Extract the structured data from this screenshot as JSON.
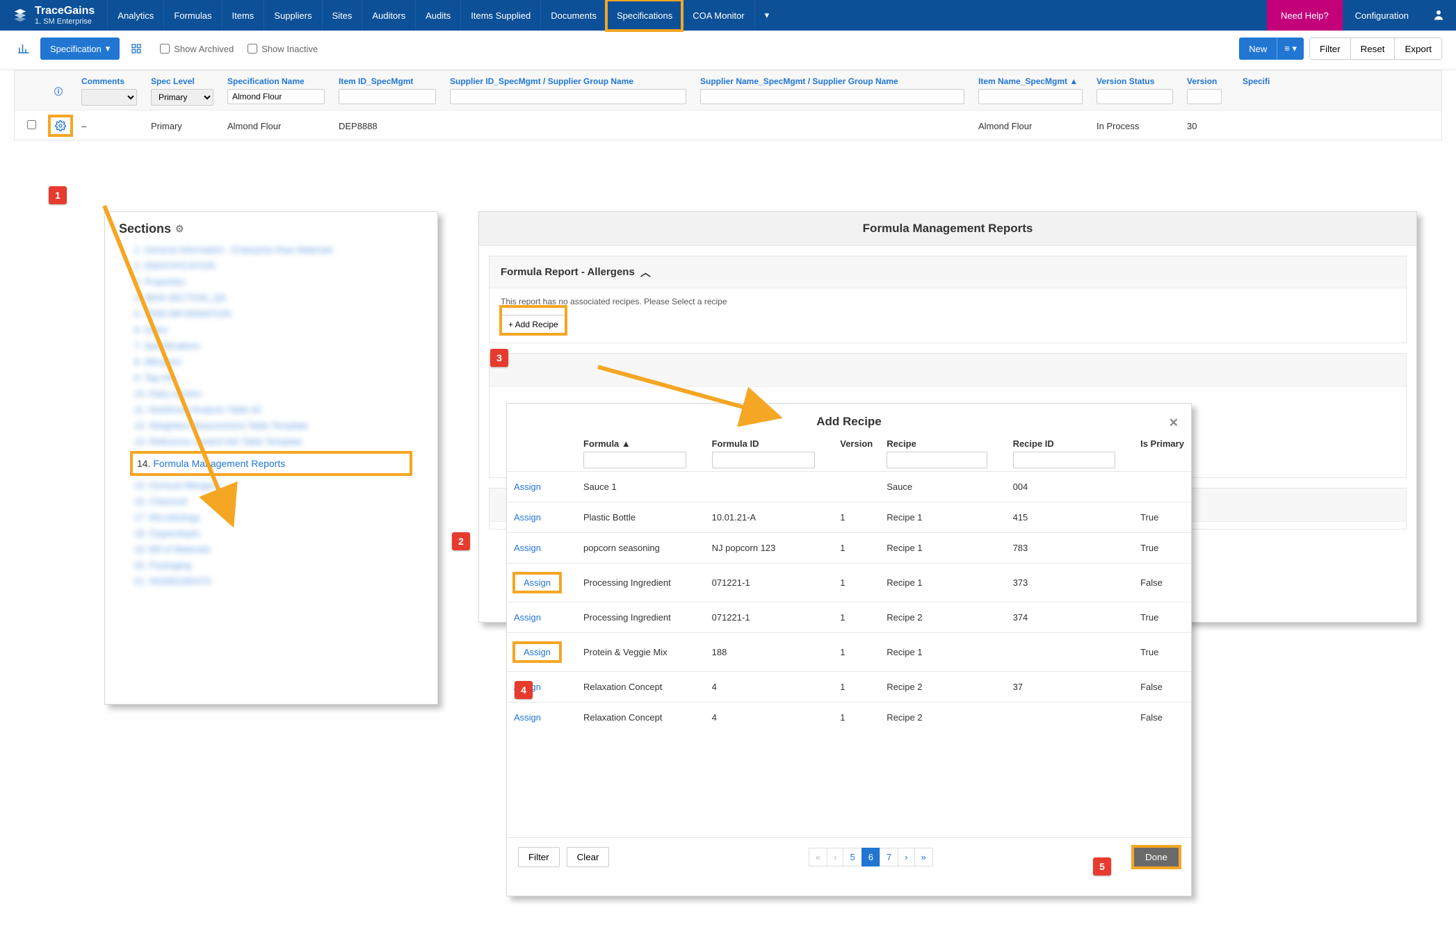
{
  "brand": {
    "name": "TraceGains",
    "sub": "1. SM Enterprise"
  },
  "nav": {
    "items": [
      "Analytics",
      "Formulas",
      "Items",
      "Suppliers",
      "Sites",
      "Auditors",
      "Audits",
      "Items Supplied",
      "Documents",
      "Specifications",
      "COA Monitor"
    ],
    "active": "Specifications",
    "needHelp": "Need Help?",
    "config": "Configuration"
  },
  "filterbar": {
    "specBtn": "Specification",
    "showArchived": "Show Archived",
    "showInactive": "Show Inactive",
    "new": "New",
    "filter": "Filter",
    "reset": "Reset",
    "export": "Export"
  },
  "grid": {
    "cols": {
      "comments": "Comments",
      "specLevel": "Spec Level",
      "specName": "Specification Name",
      "itemId": "Item ID_SpecMgmt",
      "supplierId": "Supplier ID_SpecMgmt / Supplier Group Name",
      "supplierName": "Supplier Name_SpecMgmt / Supplier Group Name",
      "itemName": "Item Name_SpecMgmt ▲",
      "versionStatus": "Version Status",
      "version": "Version",
      "specific": "Specifi"
    },
    "filterValues": {
      "specLevel": "Primary",
      "specName": "Almond Flour"
    },
    "row": {
      "comments": "–",
      "specLevel": "Primary",
      "specName": "Almond Flour",
      "itemId": "DEP8888",
      "supplierId": "",
      "supplierName": "",
      "itemName": "Almond Flour",
      "versionStatus": "In Process",
      "version": "30"
    }
  },
  "sections": {
    "title": "Sections",
    "activeIndex": "14.",
    "activeLabel": "Formula Management Reports",
    "blurred": [
      "1. General Information - Enterprise Raw Materials",
      "2. IDENTIFICATION",
      "3. Properties",
      "4. NEW SECTION_QA",
      "5. ITEM INFORMATION",
      "6. Dates",
      "7. Specifications",
      "8. Allergens",
      "9. Tag Info",
      "10. Dairy section",
      "11. Nutritional Analysis Table 62",
      "12. Weighted Measurement Table Template",
      "13. Reference content link Table Template",
      "15. General Allergens",
      "16. Chemical",
      "17. Microbiology",
      "18. Organoleptic",
      "19. Bill of Materials",
      "20. Packaging",
      "21. INGREDIENTS"
    ]
  },
  "report": {
    "header": "Formula Management Reports",
    "cardTitle": "Formula Report - Allergens",
    "msg": "This report has no associated recipes. Please Select a recipe",
    "addRecipe": "+ Add Recipe"
  },
  "dialog": {
    "title": "Add Recipe",
    "cols": {
      "formula": "Formula ▲",
      "formulaId": "Formula ID",
      "version": "Version",
      "recipe": "Recipe",
      "recipeId": "Recipe ID",
      "primary": "Is Primary"
    },
    "assign": "Assign",
    "rows": [
      {
        "formula": "Sauce 1",
        "formulaId": "",
        "version": "",
        "recipe": "Sauce",
        "recipeId": "004",
        "primary": ""
      },
      {
        "formula": "Plastic Bottle",
        "formulaId": "10.01.21-A",
        "version": "1",
        "recipe": "Recipe 1",
        "recipeId": "415",
        "primary": "True"
      },
      {
        "formula": "popcorn seasoning",
        "formulaId": "NJ popcorn 123",
        "version": "1",
        "recipe": "Recipe 1",
        "recipeId": "783",
        "primary": "True"
      },
      {
        "formula": "Processing Ingredient",
        "formulaId": "071221-1",
        "version": "1",
        "recipe": "Recipe 1",
        "recipeId": "373",
        "primary": "False"
      },
      {
        "formula": "Processing Ingredient",
        "formulaId": "071221-1",
        "version": "1",
        "recipe": "Recipe 2",
        "recipeId": "374",
        "primary": "True"
      },
      {
        "formula": "Protein & Veggie Mix",
        "formulaId": "188",
        "version": "1",
        "recipe": "Recipe 1",
        "recipeId": "",
        "primary": "True"
      },
      {
        "formula": "Relaxation Concept",
        "formulaId": "4",
        "version": "1",
        "recipe": "Recipe 2",
        "recipeId": "37",
        "primary": "False"
      },
      {
        "formula": "Relaxation Concept",
        "formulaId": "4",
        "version": "1",
        "recipe": "Recipe 2",
        "recipeId": "",
        "primary": "False"
      }
    ],
    "footer": {
      "filter": "Filter",
      "clear": "Clear",
      "done": "Done"
    },
    "pager": {
      "pages": [
        "5",
        "6",
        "7"
      ],
      "active": "6"
    }
  },
  "callouts": {
    "1": "1",
    "2": "2",
    "3": "3",
    "4": "4",
    "5": "5"
  }
}
